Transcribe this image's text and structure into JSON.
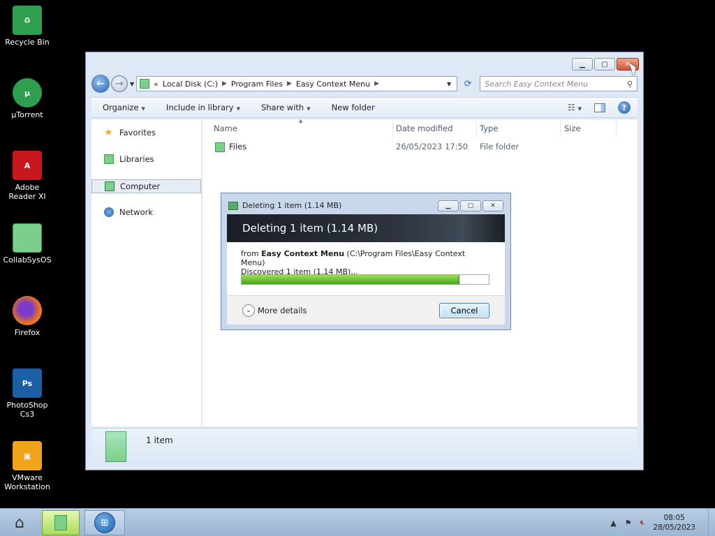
{
  "desktop": {
    "icons": [
      {
        "label": "Recycle Bin",
        "color": "#2e9e4f"
      },
      {
        "label": "µTorrent",
        "color": "#2e9e4f"
      },
      {
        "label": "Adobe Reader XI",
        "color": "#c8181e"
      },
      {
        "label": "CollabSysOS",
        "color": "#7ccf8a"
      },
      {
        "label": "Firefox",
        "color": "#e76f1d"
      },
      {
        "label": "PhotoShop Cs3",
        "color": "#1b5fa6"
      },
      {
        "label": "VMware Workstation",
        "color": "#f1a31a"
      }
    ]
  },
  "explorer": {
    "breadcrumb": [
      "Local Disk (C:)",
      "Program Files",
      "Easy Context Menu"
    ],
    "breadcrumb_prefix": "«",
    "search_placeholder": "Search Easy Context Menu",
    "toolbar": {
      "organize": "Organize",
      "include_in_library": "Include in library",
      "share_with": "Share with",
      "new_folder": "New folder"
    },
    "nav": {
      "favorites": "Favorites",
      "libraries": "Libraries",
      "computer": "Computer",
      "network": "Network"
    },
    "columns": {
      "name": "Name",
      "date_modified": "Date modified",
      "type": "Type",
      "size": "Size"
    },
    "files": [
      {
        "name": "Files",
        "date_modified": "26/05/2023 17:50",
        "type": "File folder",
        "size": ""
      }
    ],
    "item_count": "1 item"
  },
  "dialog": {
    "title": "Deleting 1 item (1.14 MB)",
    "banner": "Deleting 1 item (1.14 MB)",
    "from_prefix": "from",
    "from_name": "Easy Context Menu",
    "from_path": "(C:\\Program Files\\Easy Context Menu)",
    "discovered": "Discovered 1 item (1.14 MB)...",
    "progress_fraction": 0.88,
    "more_details": "More details",
    "cancel": "Cancel"
  },
  "taskbar": {
    "time": "08:05",
    "date": "28/05/2023"
  }
}
